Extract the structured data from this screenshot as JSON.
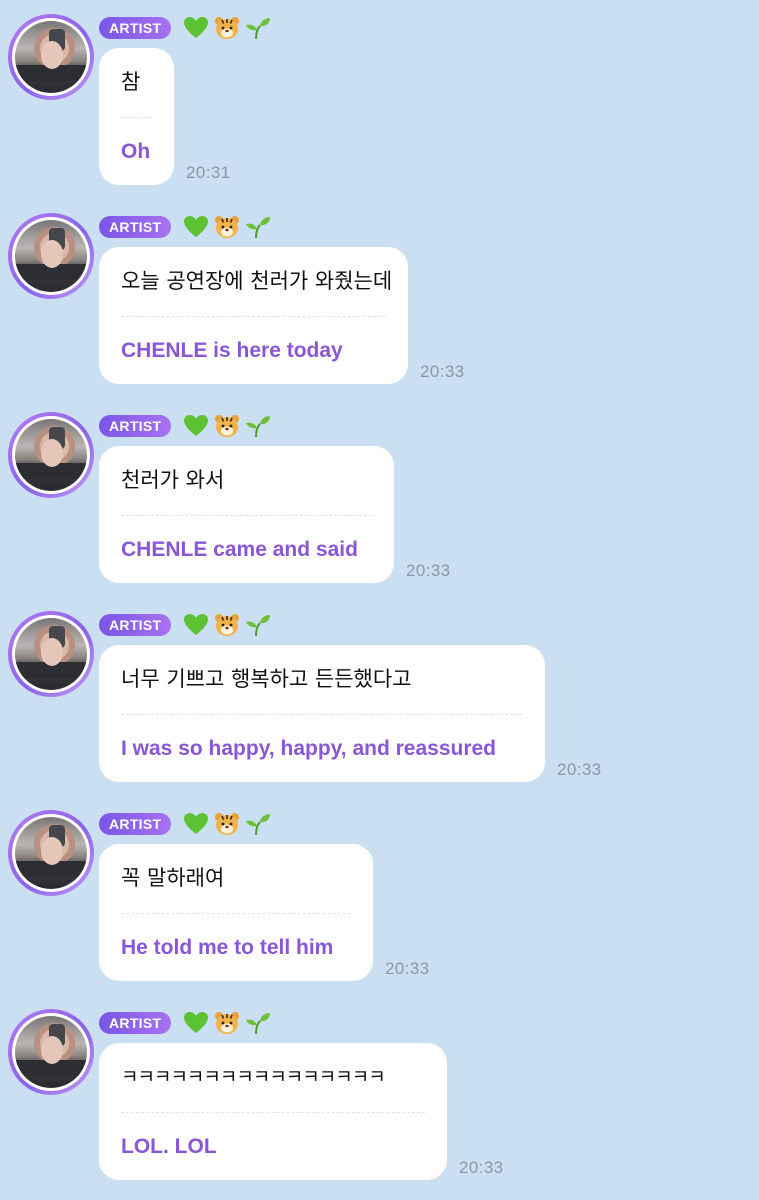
{
  "colors": {
    "background": "#cbdff3",
    "badge": "#8a62ea",
    "translation_text": "#8a56d8",
    "timestamp": "#8d96a2"
  },
  "messages": [
    {
      "badge": "ARTIST",
      "icons": [
        "green-heart-icon",
        "tiger-face-icon",
        "seedling-icon"
      ],
      "original": "참",
      "translation": "Oh",
      "time": "20:31"
    },
    {
      "badge": "ARTIST",
      "icons": [
        "green-heart-icon",
        "tiger-face-icon",
        "seedling-icon"
      ],
      "original": "오늘 공연장에 천러가 와줬는데",
      "translation": "CHENLE is here today",
      "time": "20:33"
    },
    {
      "badge": "ARTIST",
      "icons": [
        "green-heart-icon",
        "tiger-face-icon",
        "seedling-icon"
      ],
      "original": "천러가 와서",
      "translation": "CHENLE came and said",
      "time": "20:33"
    },
    {
      "badge": "ARTIST",
      "icons": [
        "green-heart-icon",
        "tiger-face-icon",
        "seedling-icon"
      ],
      "original": "너무 기쁘고 행복하고 든든했다고",
      "translation": "I was so happy, happy, and reassured",
      "time": "20:33"
    },
    {
      "badge": "ARTIST",
      "icons": [
        "green-heart-icon",
        "tiger-face-icon",
        "seedling-icon"
      ],
      "original": "꼭 말하래여",
      "translation": "He told me to tell him",
      "time": "20:33"
    },
    {
      "badge": "ARTIST",
      "icons": [
        "green-heart-icon",
        "tiger-face-icon",
        "seedling-icon"
      ],
      "original": "ㅋㅋㅋㅋㅋㅋㅋㅋㅋㅋㅋㅋㅋㅋㅋㅋ",
      "translation": "LOL. LOL",
      "time": "20:33"
    }
  ]
}
